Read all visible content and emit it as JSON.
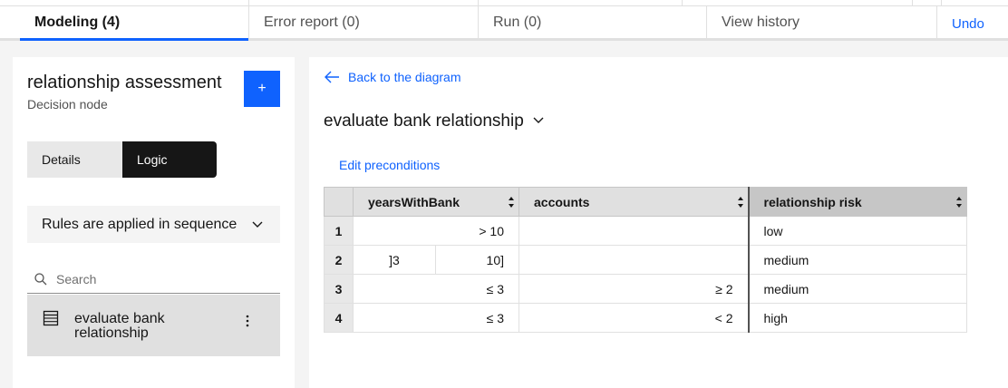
{
  "tabs": [
    {
      "label": "Modeling (4)",
      "active": true
    },
    {
      "label": "Error report (0)",
      "active": false
    },
    {
      "label": "Run (0)",
      "active": false
    },
    {
      "label": "View history",
      "active": false
    }
  ],
  "undo_label": "Undo",
  "left": {
    "title": "relationship assessment",
    "subtitle": "Decision node",
    "add_label": "+",
    "switcher": {
      "details": "Details",
      "logic": "Logic",
      "selected": "Logic"
    },
    "dropdown": {
      "value": "Rules are applied in sequence"
    },
    "search": {
      "placeholder": "Search"
    },
    "items": [
      {
        "label": "evaluate bank relationship",
        "icon": "table-icon"
      }
    ]
  },
  "right": {
    "back_label": "Back to the diagram",
    "title": "evaluate bank relationship",
    "edit_preconditions": "Edit preconditions",
    "table": {
      "headers": [
        "yearsWithBank",
        "accounts",
        "relationship risk"
      ],
      "rows": [
        {
          "index": "1",
          "years": "> 10",
          "years_from": "",
          "years_to": "",
          "accounts": "",
          "risk": "low"
        },
        {
          "index": "2",
          "years": "",
          "years_from": "]3",
          "years_to": "10]",
          "accounts": "",
          "risk": "medium"
        },
        {
          "index": "3",
          "years": "≤ 3",
          "years_from": "",
          "years_to": "",
          "accounts": "≥ 2",
          "risk": "medium"
        },
        {
          "index": "4",
          "years": "≤ 3",
          "years_from": "",
          "years_to": "",
          "accounts": "< 2",
          "risk": "high"
        }
      ]
    }
  },
  "colors": {
    "accent": "#0f62fe",
    "dark": "#161616",
    "panel_bg": "#f4f4f4"
  }
}
